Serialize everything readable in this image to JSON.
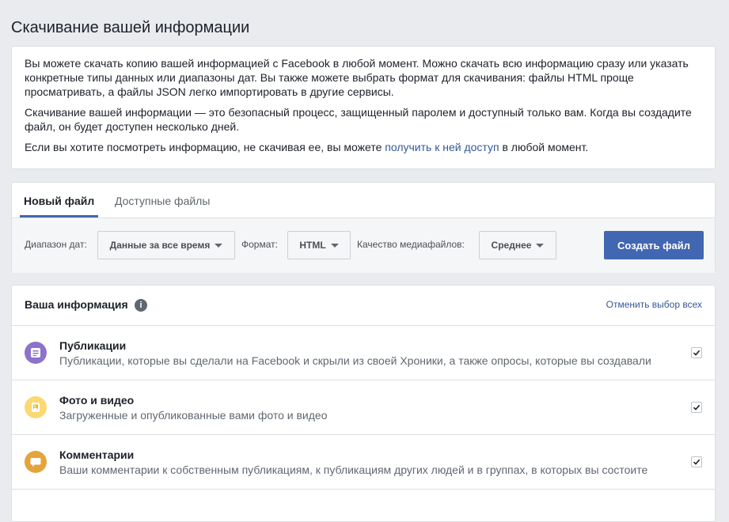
{
  "page": {
    "title": "Скачивание вашей информации"
  },
  "intro": {
    "para1": "Вы можете скачать копию вашей информацией с Facebook в любой момент. Можно скачать всю информацию сразу или указать конкретные типы данных или диапазоны дат. Вы также можете выбрать формат для скачивания: файлы HTML проще просматривать, а файлы JSON легко импортировать в другие сервисы.",
    "para2": "Скачивание вашей информации — это безопасный процесс, защищенный паролем и доступный только вам. Когда вы создадите файл, он будет доступен несколько дней.",
    "para3_before": "Если вы хотите посмотреть информацию, не скачивая ее, вы можете ",
    "para3_link": "получить к ней доступ",
    "para3_after": " в любой момент."
  },
  "tabs": {
    "new_file": "Новый файл",
    "available_files": "Доступные файлы"
  },
  "toolbar": {
    "date_range_label": "Диапазон дат:",
    "date_range_value": "Данные за все время",
    "format_label": "Формат:",
    "format_value": "HTML",
    "quality_label": "Качество медиафайлов:",
    "quality_value": "Среднее",
    "create_button": "Создать файл"
  },
  "info_list": {
    "title": "Ваша информация",
    "help_glyph": "i",
    "deselect_all": "Отменить выбор всех",
    "items": [
      {
        "title": "Публикации",
        "description": "Публикации, которые вы сделали на Facebook и скрыли из своей Хроники, а также опросы, которые вы создавали",
        "icon": "posts-icon",
        "color": "#8c72cb",
        "checked": true
      },
      {
        "title": "Фото и видео",
        "description": "Загруженные и опубликованные вами фото и видео",
        "icon": "photo-icon",
        "color": "#fcd872",
        "checked": true
      },
      {
        "title": "Комментарии",
        "description": "Ваши комментарии к собственным публикациям, к публикациям других людей и в группах, в которых вы состоите",
        "icon": "comment-icon",
        "color": "#e5a33b",
        "checked": true
      }
    ]
  },
  "colors": {
    "accent": "#4267b2",
    "link": "#365899",
    "background": "#e9ebee"
  }
}
